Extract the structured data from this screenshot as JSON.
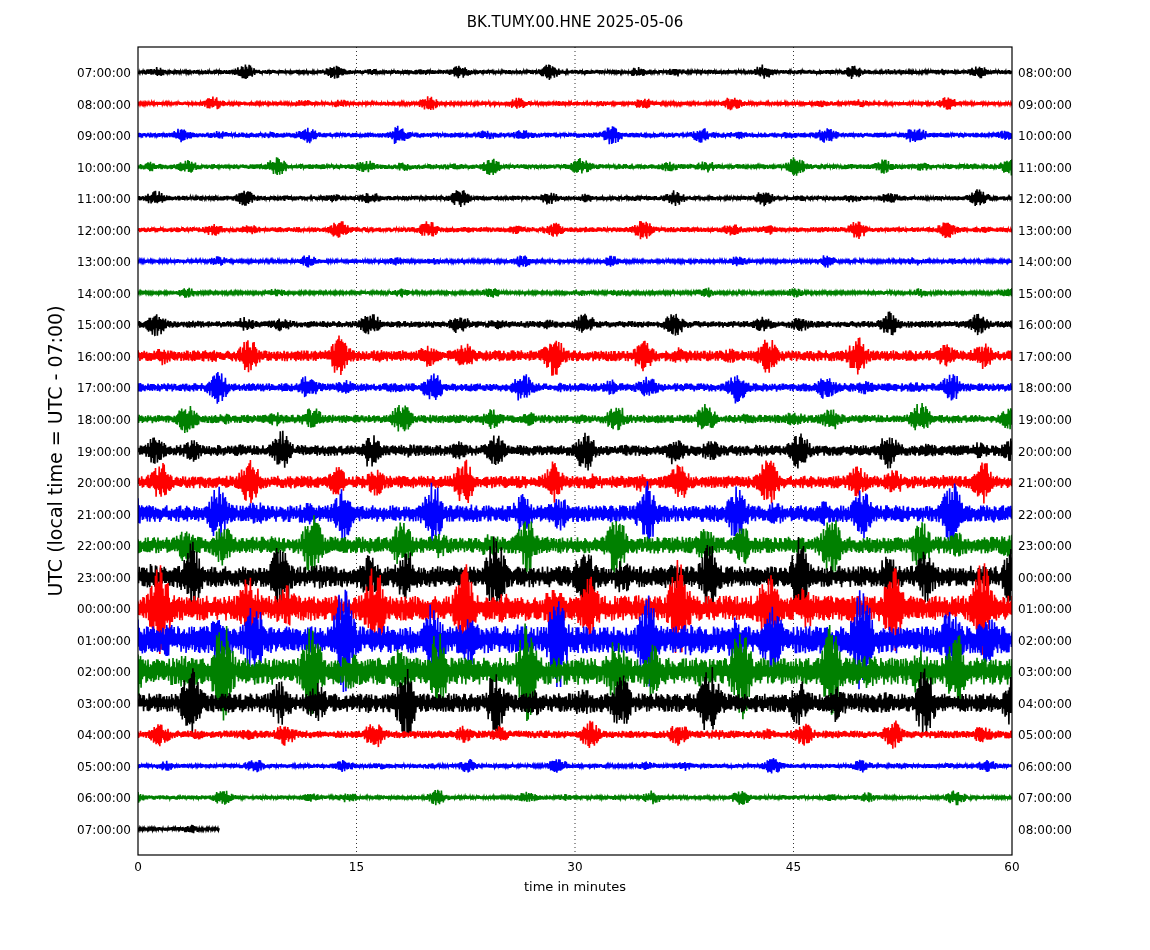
{
  "chart": {
    "title": "BK.TUMY.00.HNE 2025-05-06",
    "ylabel": "UTC (local time = UTC - 07:00)",
    "xlabel": "time in minutes",
    "xticks": [
      "0",
      "15",
      "30",
      "45",
      "60"
    ],
    "traces": [
      {
        "left_label": "07:00:00",
        "right_label": "08:00:00",
        "color": "#000000",
        "level": 1
      },
      {
        "left_label": "08:00:00",
        "right_label": "09:00:00",
        "color": "#ff0000",
        "level": 1
      },
      {
        "left_label": "09:00:00",
        "right_label": "10:00:00",
        "color": "#0000ff",
        "level": 1
      },
      {
        "left_label": "10:00:00",
        "right_label": "11:00:00",
        "color": "#008000",
        "level": 1
      },
      {
        "left_label": "11:00:00",
        "right_label": "12:00:00",
        "color": "#000000",
        "level": 1
      },
      {
        "left_label": "12:00:00",
        "right_label": "13:00:00",
        "color": "#ff0000",
        "level": 1
      },
      {
        "left_label": "13:00:00",
        "right_label": "14:00:00",
        "color": "#0000ff",
        "level": 1
      },
      {
        "left_label": "14:00:00",
        "right_label": "15:00:00",
        "color": "#008000",
        "level": 1
      },
      {
        "left_label": "15:00:00",
        "right_label": "16:00:00",
        "color": "#000000",
        "level": 1
      },
      {
        "left_label": "16:00:00",
        "right_label": "17:00:00",
        "color": "#ff0000",
        "level": 1
      },
      {
        "left_label": "17:00:00",
        "right_label": "18:00:00",
        "color": "#0000ff",
        "level": 1
      },
      {
        "left_label": "18:00:00",
        "right_label": "19:00:00",
        "color": "#008000",
        "level": 1
      },
      {
        "left_label": "19:00:00",
        "right_label": "20:00:00",
        "color": "#000000",
        "level": 1
      },
      {
        "left_label": "20:00:00",
        "right_label": "21:00:00",
        "color": "#ff0000",
        "level": 1
      },
      {
        "left_label": "21:00:00",
        "right_label": "22:00:00",
        "color": "#0000ff",
        "level": 1
      },
      {
        "left_label": "22:00:00",
        "right_label": "23:00:00",
        "color": "#008000",
        "level": 1
      },
      {
        "left_label": "23:00:00",
        "right_label": "00:00:00",
        "color": "#000000",
        "level": 1
      },
      {
        "left_label": "00:00:00",
        "right_label": "01:00:00",
        "color": "#ff0000",
        "level": 1
      },
      {
        "left_label": "01:00:00",
        "right_label": "02:00:00",
        "color": "#0000ff",
        "level": 1
      },
      {
        "left_label": "02:00:00",
        "right_label": "03:00:00",
        "color": "#008000",
        "level": 1
      },
      {
        "left_label": "03:00:00",
        "right_label": "04:00:00",
        "color": "#000000",
        "level": 1
      },
      {
        "left_label": "04:00:00",
        "right_label": "05:00:00",
        "color": "#ff0000",
        "level": 1
      },
      {
        "left_label": "05:00:00",
        "right_label": "06:00:00",
        "color": "#0000ff",
        "level": 1
      },
      {
        "left_label": "06:00:00",
        "right_label": "07:00:00",
        "color": "#008000",
        "level": 1
      },
      {
        "left_label": "07:00:00",
        "right_label": "08:00:00",
        "color": "#000000",
        "level": 0.093
      }
    ]
  }
}
